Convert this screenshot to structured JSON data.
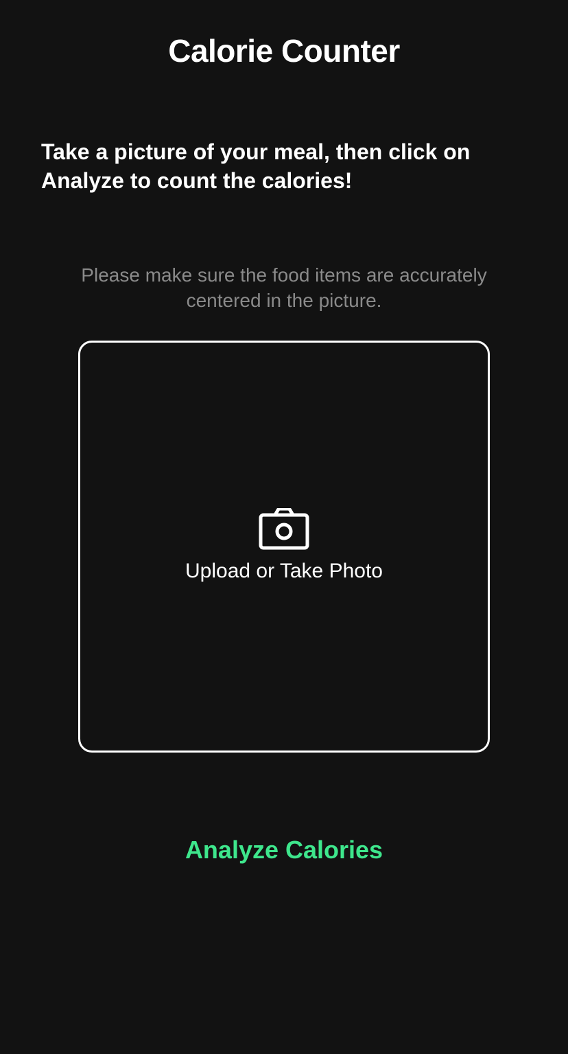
{
  "header": {
    "title": "Calorie Counter"
  },
  "main": {
    "instructions": "Take a picture of your meal, then click on Analyze to count the calories!",
    "hint": "Please make sure the food items are accurately centered in the picture.",
    "upload": {
      "icon": "camera-icon",
      "label": "Upload or Take Photo"
    },
    "analyze_button_label": "Analyze Calories"
  },
  "colors": {
    "background": "#121212",
    "text": "#ffffff",
    "hint_text": "#8a8a8a",
    "accent": "#3ee68c"
  }
}
